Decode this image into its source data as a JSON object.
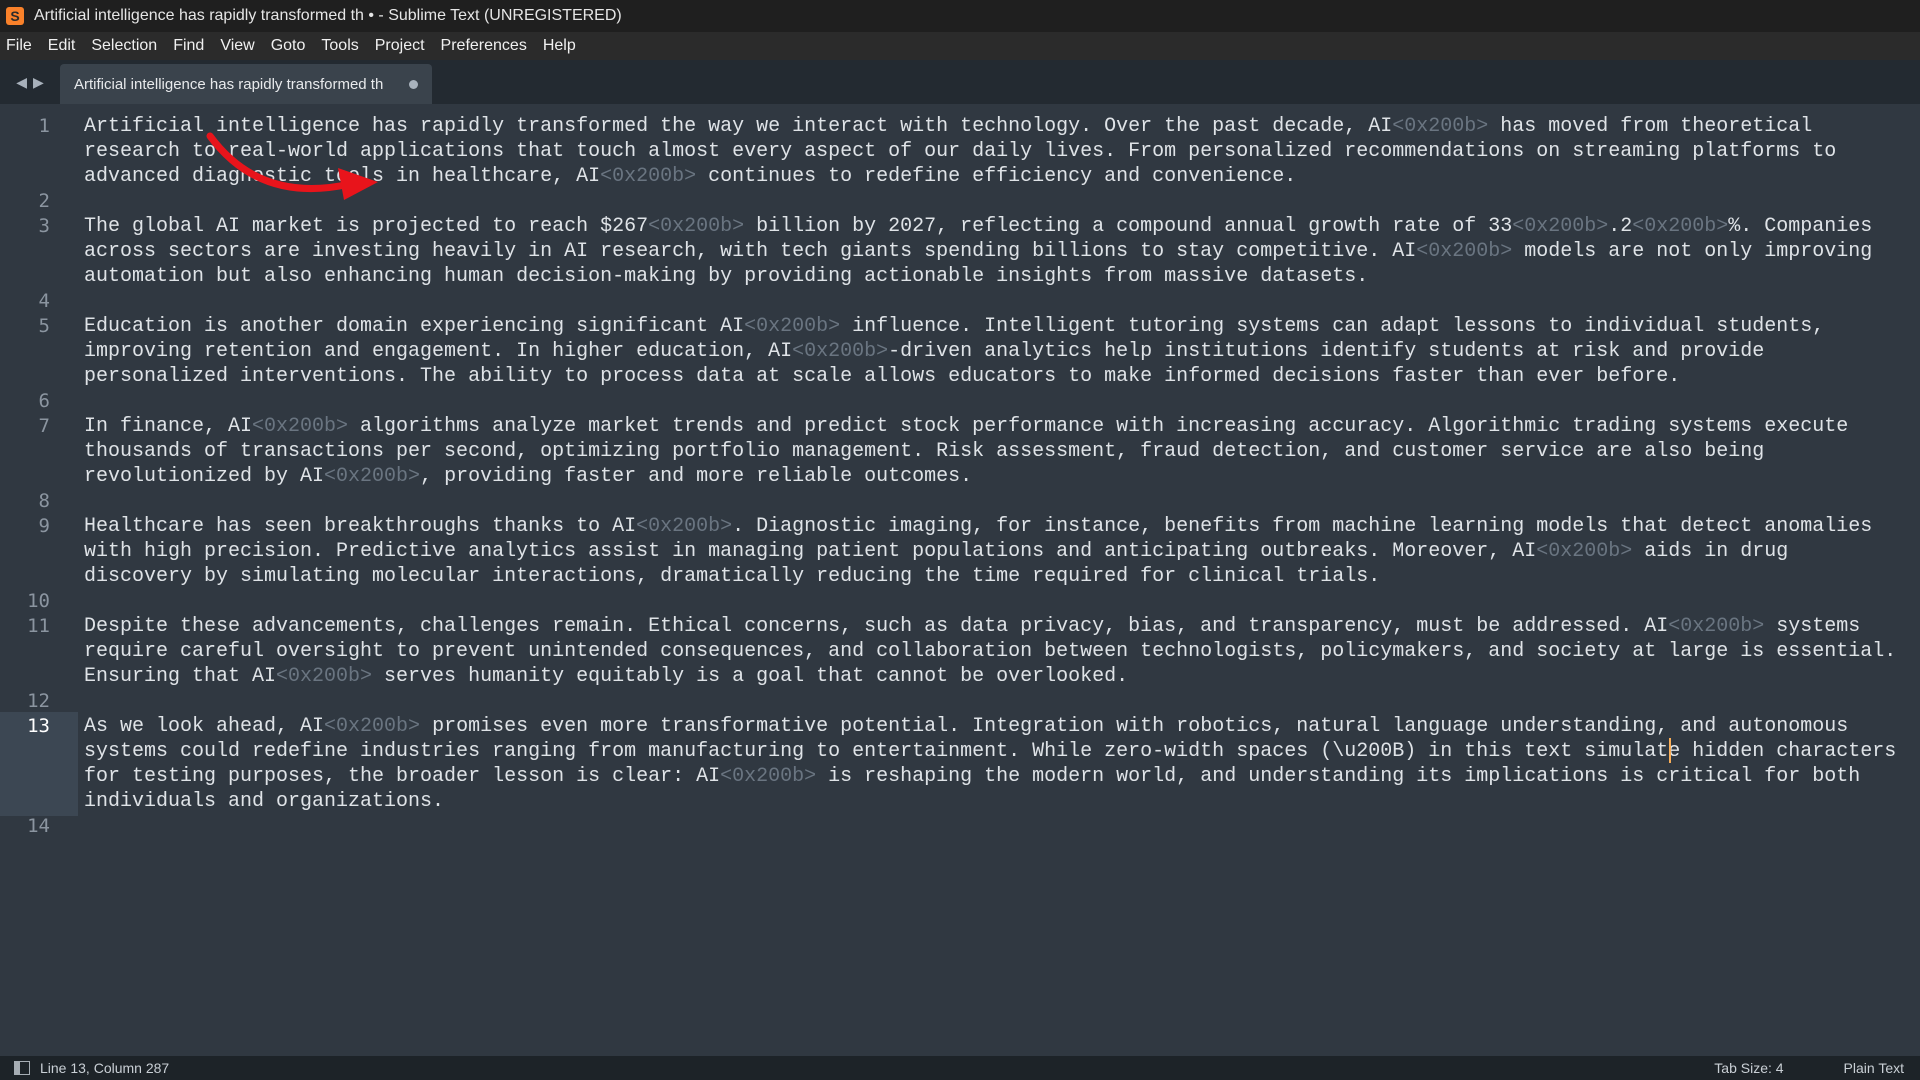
{
  "window": {
    "title": "Artificial intelligence has rapidly transformed th • - Sublime Text (UNREGISTERED)",
    "app_icon_glyph": "S"
  },
  "menu": [
    "File",
    "Edit",
    "Selection",
    "Find",
    "View",
    "Goto",
    "Tools",
    "Project",
    "Preferences",
    "Help"
  ],
  "tabs": {
    "nav_back": "◀",
    "nav_forward": "▶",
    "active_tab_label": "Artificial intelligence has rapidly transformed th"
  },
  "editor": {
    "zw_marker": "<0x200b>",
    "active_line": "13",
    "lines": [
      {
        "n": "1",
        "segments": [
          "Artificial intelligence has rapidly transformed the way we interact with technology. Over the past decade, AI",
          "{zw}",
          " has moved from theoretical research to real-world applications that touch almost every aspect of our daily lives. From personalized recommendations on streaming platforms to advanced diagnostic tools in healthcare, AI",
          "{zw}",
          " continues to redefine efficiency and convenience."
        ]
      },
      {
        "n": "2",
        "segments": [
          ""
        ]
      },
      {
        "n": "3",
        "segments": [
          "The global AI market is projected to reach $267",
          "{zw}",
          " billion by 2027, reflecting a compound annual growth rate of 33",
          "{zw}",
          ".2",
          "{zw}",
          "%. Companies across sectors are investing heavily in AI research, with tech giants spending billions to stay competitive. AI",
          "{zw}",
          " models are not only improving automation but also enhancing human decision-making by providing actionable insights from massive datasets."
        ]
      },
      {
        "n": "4",
        "segments": [
          ""
        ]
      },
      {
        "n": "5",
        "segments": [
          "Education is another domain experiencing significant AI",
          "{zw}",
          " influence. Intelligent tutoring systems can adapt lessons to individual students, improving retention and engagement. In higher education, AI",
          "{zw}",
          "-driven analytics help institutions identify students at risk and provide personalized interventions. The ability to process data at scale allows educators to make informed decisions faster than ever before."
        ]
      },
      {
        "n": "6",
        "segments": [
          ""
        ]
      },
      {
        "n": "7",
        "segments": [
          "In finance, AI",
          "{zw}",
          " algorithms analyze market trends and predict stock performance with increasing accuracy. Algorithmic trading systems execute thousands of transactions per second, optimizing portfolio management. Risk assessment, fraud detection, and customer service are also being revolutionized by AI",
          "{zw}",
          ", providing faster and more reliable outcomes."
        ]
      },
      {
        "n": "8",
        "segments": [
          ""
        ]
      },
      {
        "n": "9",
        "segments": [
          "Healthcare has seen breakthroughs thanks to AI",
          "{zw}",
          ". Diagnostic imaging, for instance, benefits from machine learning models that detect anomalies with high precision. Predictive analytics assist in managing patient populations and anticipating outbreaks. Moreover, AI",
          "{zw}",
          " aids in drug discovery by simulating molecular interactions, dramatically reducing the time required for clinical trials."
        ]
      },
      {
        "n": "10",
        "segments": [
          ""
        ]
      },
      {
        "n": "11",
        "segments": [
          "Despite these advancements, challenges remain. Ethical concerns, such as data privacy, bias, and transparency, must be addressed. AI",
          "{zw}",
          " systems require careful oversight to prevent unintended consequences, and collaboration between technologists, policymakers, and society at large is essential. Ensuring that AI",
          "{zw}",
          " serves humanity equitably is a goal that cannot be overlooked."
        ]
      },
      {
        "n": "12",
        "segments": [
          ""
        ]
      },
      {
        "n": "13",
        "segments": [
          "As we look ahead, AI",
          "{zw}",
          " promises even more transformative potential. Integration with robotics, natural language understanding, and autonomous systems could redefine industries ranging from manufacturing to entertainment. While zero-width spaces (\\u200B) in this text simulate hidden characters for testing purposes, the broader lesson is clear: AI",
          "{zw}",
          " is reshaping the modern world, and understanding its implications is critical for both individuals and organizations."
        ]
      },
      {
        "n": "14",
        "segments": [
          ""
        ]
      }
    ]
  },
  "status": {
    "position": "Line 13, Column 287",
    "tab_size": "Tab Size: 4",
    "syntax": "Plain Text"
  },
  "colors": {
    "background": "#303841",
    "text": "#dfe3e7",
    "zw_marker": "#6a7581",
    "arrow": "#e8141b",
    "caret": "#f9ae58"
  }
}
